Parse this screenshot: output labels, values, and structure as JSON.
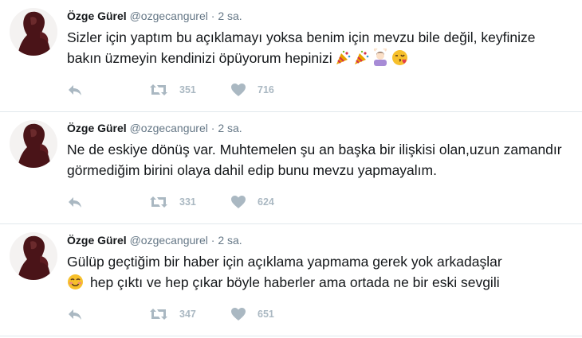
{
  "tweets": [
    {
      "author_name": "Özge Gürel",
      "handle": "@ozgecangurel",
      "separator": "·",
      "time": "2 sa.",
      "text": "Sizler için yaptım bu açıklamayı yoksa  benim için mevzu bile değil, keyfinize bakın üzmeyin kendinizi öpüyorum hepinizi",
      "trailing_emojis": [
        "party-popper-icon",
        "party-popper-icon",
        "person-gesturing-ok-icon",
        "face-blowing-kiss-icon"
      ],
      "retweets": "351",
      "likes": "716"
    },
    {
      "author_name": "Özge Gürel",
      "handle": "@ozgecangurel",
      "separator": "·",
      "time": "2 sa.",
      "text": "Ne de eskiye dönüş var. Muhtemelen şu an başka bir ilişkisi olan,uzun zamandır görmediğim birini olaya dahil edip bunu mevzu yapmayalım.",
      "retweets": "331",
      "likes": "624"
    },
    {
      "author_name": "Özge Gürel",
      "handle": "@ozgecangurel",
      "separator": "·",
      "time": "2 sa.",
      "text_line1": "Gülüp geçtiğim bir haber için açıklama yapmama gerek yok arkadaşlar",
      "leading_emoji": "smiling-face-icon",
      "text_line2": "hep çıktı ve hep çıkar böyle haberler ama ortada ne bir eski sevgili",
      "retweets": "347",
      "likes": "651"
    }
  ],
  "colors": {
    "text": "#14171a",
    "secondary": "#657786",
    "action_icons": "#aab8c2",
    "divider": "#e1e8ed",
    "avatar_dark": "#4a1418"
  }
}
